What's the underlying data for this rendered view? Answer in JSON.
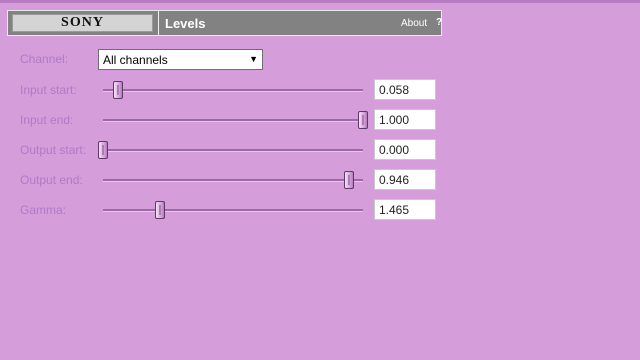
{
  "header": {
    "logo": "SONY",
    "title": "Levels",
    "about_label": "About",
    "help_label": "?"
  },
  "channel": {
    "label": "Channel:",
    "selected": "All channels"
  },
  "sliders": [
    {
      "label": "Input start:",
      "value": "0.058",
      "position": 0.058
    },
    {
      "label": "Input end:",
      "value": "1.000",
      "position": 1.0
    },
    {
      "label": "Output start:",
      "value": "0.000",
      "position": 0.0
    },
    {
      "label": "Output end:",
      "value": "0.946",
      "position": 0.946
    },
    {
      "label": "Gamma:",
      "value": "1.465",
      "position": 0.22
    }
  ],
  "colors": {
    "background": "#d59edb",
    "header": "#828282",
    "label_text": "#b07ac4"
  }
}
